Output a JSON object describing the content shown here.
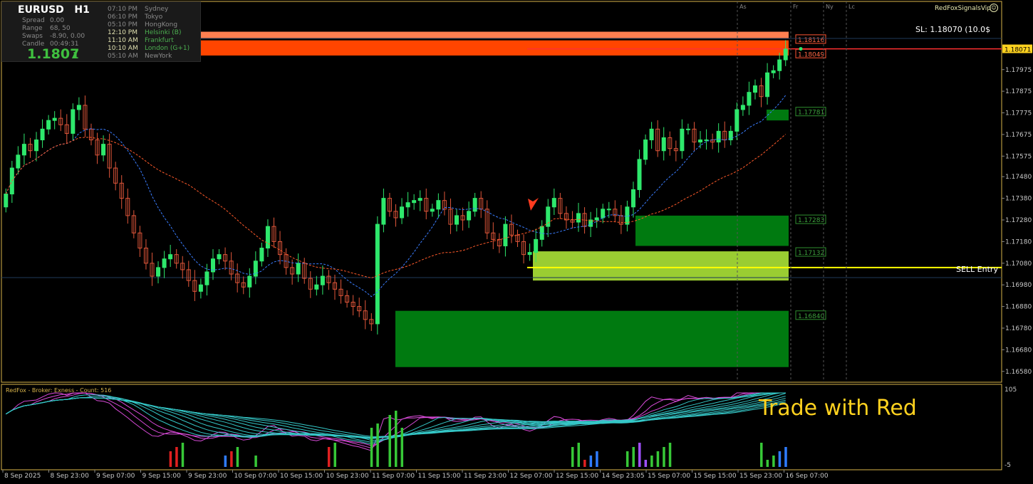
{
  "info": {
    "symbol": "EURUSD",
    "timeframe": "H1",
    "labels": [
      "Spread",
      "Range",
      "Swaps",
      "Candle"
    ],
    "values": [
      "0.00",
      "68, 50",
      "-8.90, 0.00",
      "00:49:31"
    ],
    "price_big": "1.1807",
    "price_small": "1",
    "sessions": [
      {
        "time": "07:10 PM",
        "name": "Sydney",
        "state": "normal"
      },
      {
        "time": "06:10 PM",
        "name": "Tokyo",
        "state": "normal"
      },
      {
        "time": "05:10 PM",
        "name": "HongKong",
        "state": "normal"
      },
      {
        "time": "12:10 PM",
        "name": "Helsinki  (B)",
        "state": "green"
      },
      {
        "time": "11:10 AM",
        "name": "Frankfurt",
        "state": "green"
      },
      {
        "time": "10:10 AM",
        "name": "London  (G+1)",
        "state": "green"
      },
      {
        "time": "05:10 AM",
        "name": "NewYork",
        "state": "normal"
      }
    ]
  },
  "brand": "RedFoxSignalsVip",
  "stop_loss_label": "SL: 1.18070 (10.0$",
  "sell_entry_label": "SELL Entry",
  "trade_with_label": "Trade with Red",
  "subwindow_label": "RedFox - Broker: Exness - Count: 516",
  "subwindow_scale": [
    "105",
    "-5"
  ],
  "session_markers": [
    "As",
    "Fr",
    "Ny",
    "Lc"
  ],
  "colors": {
    "bull": "#2ee86c",
    "bear": "#e0563a",
    "ma_fast": "#3a7dff",
    "ma_slow": "#ff5a2a",
    "zone_dark_green": "#007a10",
    "zone_light_green": "#9acd32",
    "zone_red": "#ff4500",
    "zone_orange": "#ff7f50",
    "sell_line": "#ffff00",
    "price_line": "#ff3030",
    "grid_line": "#1f3a5a",
    "axis_text": "#c8c8c8"
  },
  "chart_data": {
    "type": "candlestick",
    "symbol": "EURUSD",
    "timeframe": "H1",
    "current_price": 1.18071,
    "ylim": [
      1.1653,
      1.1829
    ],
    "y_ticks": [
      "1.17975",
      "1.17875",
      "1.17775",
      "1.17675",
      "1.17575",
      "1.17480",
      "1.17380",
      "1.17280",
      "1.17180",
      "1.17080",
      "1.16980",
      "1.16880",
      "1.16780",
      "1.16680",
      "1.16580"
    ],
    "x_ticks": [
      "8 Sep 2025",
      "8 Sep 23:00",
      "9 Sep 07:00",
      "9 Sep 15:00",
      "9 Sep 23:00",
      "10 Sep 07:00",
      "10 Sep 15:00",
      "10 Sep 23:00",
      "11 Sep 07:00",
      "11 Sep 15:00",
      "11 Sep 23:00",
      "12 Sep 07:00",
      "12 Sep 15:00",
      "14 Sep 23:05",
      "15 Sep 07:00",
      "15 Sep 15:00",
      "15 Sep 23:00",
      "16 Sep 07:00"
    ],
    "closes": [
      1.174,
      1.1752,
      1.1758,
      1.1763,
      1.176,
      1.1765,
      1.177,
      1.1774,
      1.1775,
      1.1772,
      1.1768,
      1.1779,
      1.1781,
      1.177,
      1.1765,
      1.1758,
      1.1763,
      1.1752,
      1.1745,
      1.1738,
      1.173,
      1.1722,
      1.1715,
      1.1708,
      1.1702,
      1.1706,
      1.171,
      1.1712,
      1.1708,
      1.1705,
      1.17,
      1.1695,
      1.1698,
      1.1704,
      1.171,
      1.1712,
      1.1709,
      1.1703,
      1.1699,
      1.1697,
      1.1702,
      1.1709,
      1.1715,
      1.1725,
      1.1718,
      1.1712,
      1.1706,
      1.1703,
      1.1708,
      1.1701,
      1.1696,
      1.1698,
      1.1702,
      1.1699,
      1.1696,
      1.1693,
      1.169,
      1.1688,
      1.1686,
      1.1682,
      1.168,
      1.1726,
      1.1738,
      1.1732,
      1.1729,
      1.1734,
      1.1736,
      1.1737,
      1.1738,
      1.1732,
      1.1733,
      1.1737,
      1.1733,
      1.1726,
      1.173,
      1.1728,
      1.1732,
      1.1738,
      1.1733,
      1.1722,
      1.1719,
      1.1716,
      1.1726,
      1.1721,
      1.1718,
      1.1712,
      1.1713,
      1.1719,
      1.1725,
      1.1734,
      1.1738,
      1.1731,
      1.1728,
      1.1727,
      1.1731,
      1.1725,
      1.1728,
      1.1729,
      1.1733,
      1.1733,
      1.173,
      1.1726,
      1.1734,
      1.1742,
      1.1756,
      1.1765,
      1.177,
      1.176,
      1.1766,
      1.1761,
      1.176,
      1.177,
      1.177,
      1.1764,
      1.1765,
      1.1765,
      1.1764,
      1.1769,
      1.1765,
      1.1769,
      1.1779,
      1.1781,
      1.1787,
      1.179,
      1.1785,
      1.1796,
      1.1797,
      1.1802,
      1.1807
    ],
    "zones": [
      {
        "type": "supply",
        "level": "1.18116",
        "top": 1.1815,
        "bottom": 1.1812
      },
      {
        "type": "supply",
        "level": "1.18049",
        "top": 1.1811,
        "bottom": 1.1804
      },
      {
        "type": "demand",
        "level": "1.17781",
        "top": 1.1779,
        "bottom": 1.1774
      },
      {
        "type": "demand",
        "level": "1.17283",
        "top": 1.173,
        "bottom": 1.1716
      },
      {
        "type": "demand",
        "level": "1.17132",
        "top": 1.17135,
        "bottom": 1.17
      },
      {
        "type": "demand",
        "level": "1.16840",
        "top": 1.1686,
        "bottom": 1.166
      }
    ],
    "sell_entry": 1.1706,
    "stop_loss": 1.1807
  }
}
